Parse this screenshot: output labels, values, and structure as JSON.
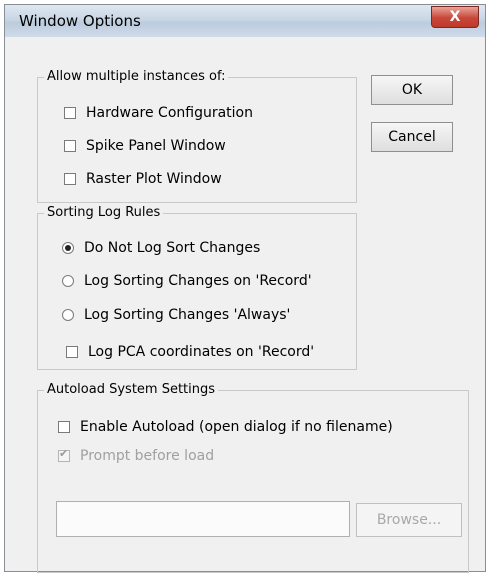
{
  "window": {
    "title": "Window Options",
    "close_glyph": "X"
  },
  "buttons": {
    "ok": "OK",
    "cancel": "Cancel",
    "browse": "Browse..."
  },
  "instances_group": {
    "legend": "Allow multiple instances of:",
    "items": [
      {
        "label": "Hardware Configuration",
        "checked": false
      },
      {
        "label": "Spike Panel Window",
        "checked": false
      },
      {
        "label": "Raster Plot Window",
        "checked": false
      }
    ]
  },
  "sorting_group": {
    "legend": "Sorting Log Rules",
    "options": [
      {
        "label": "Do Not Log Sort Changes",
        "selected": true
      },
      {
        "label": "Log Sorting Changes on 'Record'",
        "selected": false
      },
      {
        "label": "Log Sorting Changes 'Always'",
        "selected": false
      }
    ],
    "pca_checkbox": {
      "label": "Log PCA coordinates on 'Record'",
      "checked": false
    }
  },
  "autoload_group": {
    "legend": "Autoload System Settings",
    "enable_checkbox": {
      "label": "Enable Autoload (open dialog if no filename)",
      "checked": false
    },
    "prompt_checkbox": {
      "label": "Prompt before load",
      "checked": true,
      "enabled": false
    },
    "filename_value": ""
  },
  "colors": {
    "dialog_bg": "#f0f0f0",
    "close_button": "#c7473a"
  }
}
